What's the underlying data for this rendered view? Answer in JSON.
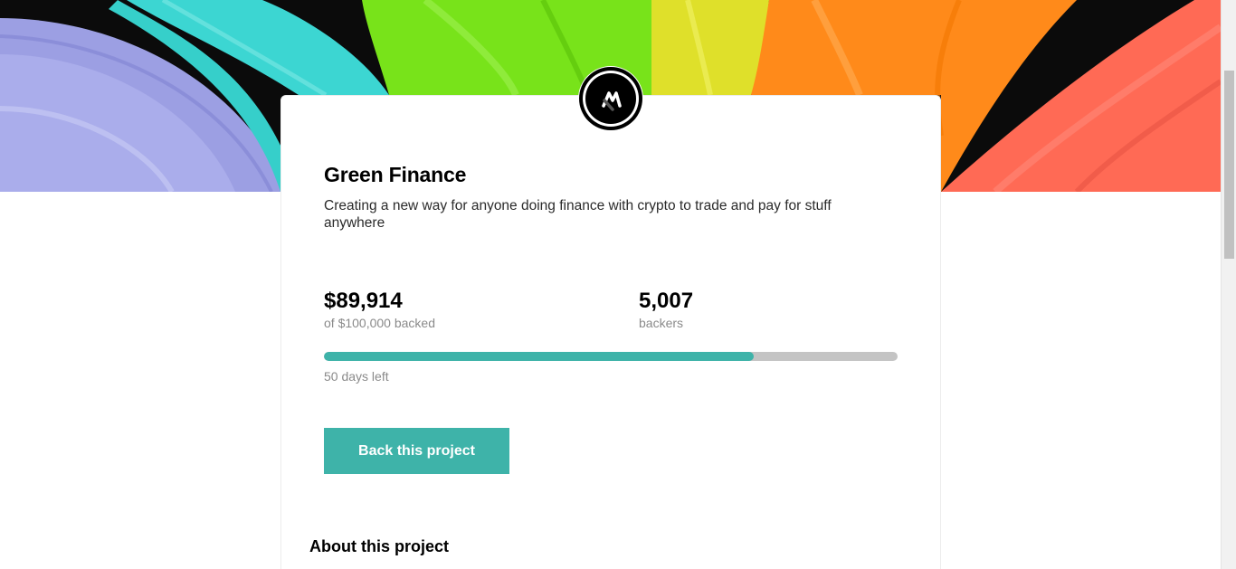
{
  "project": {
    "title": "Green Finance",
    "description": "Creating a new way for anyone doing finance with crypto to trade and pay for stuff anywhere",
    "logo_icon": "mastercraft-logo-icon"
  },
  "stats": {
    "amount_backed": "$89,914",
    "amount_backed_label": "of $100,000 backed",
    "backers": "5,007",
    "backers_label": "backers",
    "progress_fraction": 0.749,
    "days_left": "50 days left"
  },
  "actions": {
    "back_label": "Back this project"
  },
  "about": {
    "heading": "About this project"
  },
  "colors": {
    "accent": "#3eb3a9",
    "progress_track": "#c4c4c4",
    "muted_text": "#8a8a8a"
  }
}
